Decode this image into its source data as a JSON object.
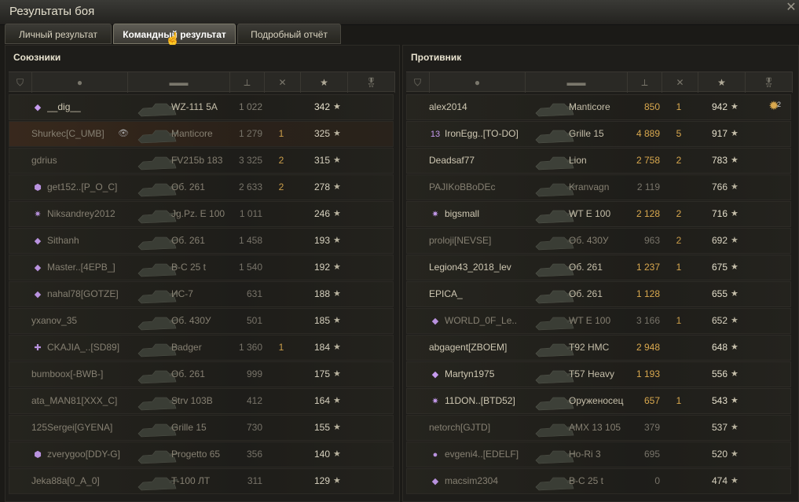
{
  "window": {
    "title": "Результаты боя",
    "close_icon": "close-icon"
  },
  "tabs": [
    {
      "label": "Личный результат",
      "active": false
    },
    {
      "label": "Командный результат",
      "active": true
    },
    {
      "label": "Подробный отчёт",
      "active": false
    }
  ],
  "colors": {
    "damage_highlight": "#d9a84e",
    "text": "#c9c2ad",
    "bg": "#1e1d1a"
  },
  "left": {
    "title": "Союзники",
    "columns": [
      "squad-icon",
      "player-icon",
      "tank-icon",
      "damage-icon",
      "kills-icon",
      "xp-star-icon",
      "medal-icon"
    ],
    "rows": [
      {
        "badge": "◆",
        "name": "__dig__",
        "tank": "WZ-111 5A",
        "damage": "1 022",
        "kills": "",
        "xp": "342",
        "self": false,
        "dead": false
      },
      {
        "badge": "",
        "name": "Shurkec[C_UMB]",
        "tank": "Manticore",
        "damage": "1 279",
        "kills": "1",
        "xp": "325",
        "self": true,
        "dead": true
      },
      {
        "badge": "",
        "name": "gdrius",
        "tank": "FV215b 183",
        "damage": "3 325",
        "kills": "2",
        "xp": "315",
        "self": false,
        "dead": true
      },
      {
        "badge": "⬢",
        "name": "get152..[P_O_C]",
        "tank": "Об. 261",
        "damage": "2 633",
        "kills": "2",
        "xp": "278",
        "self": false,
        "dead": true
      },
      {
        "badge": "✷",
        "name": "Niksandrey2012",
        "tank": "Jg.Pz. E 100",
        "damage": "1 011",
        "kills": "",
        "xp": "246",
        "self": false,
        "dead": true
      },
      {
        "badge": "◆",
        "name": "Sithanh",
        "tank": "Об. 261",
        "damage": "1 458",
        "kills": "",
        "xp": "193",
        "self": false,
        "dead": true
      },
      {
        "badge": "◆",
        "name": "Master..[4EPB_]",
        "tank": "B-C 25 t",
        "damage": "1 540",
        "kills": "",
        "xp": "192",
        "self": false,
        "dead": true
      },
      {
        "badge": "◆",
        "name": "nahal78[GOTZE]",
        "tank": "ИС-7",
        "damage": "631",
        "kills": "",
        "xp": "188",
        "self": false,
        "dead": true
      },
      {
        "badge": "",
        "name": "yxanov_35",
        "tank": "Об. 430У",
        "damage": "501",
        "kills": "",
        "xp": "185",
        "self": false,
        "dead": true
      },
      {
        "badge": "✚",
        "name": "CKAJIA_..[SD89]",
        "tank": "Badger",
        "damage": "1 360",
        "kills": "1",
        "xp": "184",
        "self": false,
        "dead": true
      },
      {
        "badge": "",
        "name": "bumboox[-BWB-]",
        "tank": "Об. 261",
        "damage": "999",
        "kills": "",
        "xp": "175",
        "self": false,
        "dead": true
      },
      {
        "badge": "",
        "name": "ata_MAN81[XXX_C]",
        "tank": "Strv 103B",
        "damage": "412",
        "kills": "",
        "xp": "164",
        "self": false,
        "dead": true
      },
      {
        "badge": "",
        "name": "125Sergei[GYENA]",
        "tank": "Grille 15",
        "damage": "730",
        "kills": "",
        "xp": "155",
        "self": false,
        "dead": true
      },
      {
        "badge": "⬢",
        "name": "zverygoo[DDY-G]",
        "tank": "Progetto 65",
        "damage": "356",
        "kills": "",
        "xp": "140",
        "self": false,
        "dead": true
      },
      {
        "badge": "",
        "name": "Jeka88a[0_A_0]",
        "tank": "T-100 ЛТ",
        "damage": "311",
        "kills": "",
        "xp": "129",
        "self": false,
        "dead": true
      }
    ]
  },
  "right": {
    "title": "Противник",
    "rows": [
      {
        "badge": "",
        "name": "alex2014",
        "tank": "Manticore",
        "damage": "850",
        "kills": "1",
        "xp": "942",
        "medal": "2",
        "hi": true,
        "dead": false
      },
      {
        "badge": "13",
        "name": "IronEgg..[TO-DO]",
        "tank": "Grille 15",
        "damage": "4 889",
        "kills": "5",
        "xp": "917",
        "medal": "",
        "hi": true,
        "dead": false
      },
      {
        "badge": "",
        "name": "Deadsaf77",
        "tank": "Lion",
        "damage": "2 758",
        "kills": "2",
        "xp": "783",
        "medal": "",
        "hi": true,
        "dead": false
      },
      {
        "badge": "",
        "name": "PAJIKoBBoDEc",
        "tank": "Kranvagn",
        "damage": "2 119",
        "kills": "",
        "xp": "766",
        "medal": "",
        "hi": false,
        "dead": true
      },
      {
        "badge": "✷",
        "name": "bigsmall",
        "tank": "WT E 100",
        "damage": "2 128",
        "kills": "2",
        "xp": "716",
        "medal": "",
        "hi": true,
        "dead": false
      },
      {
        "badge": "",
        "name": "proloji[NEVSE]",
        "tank": "Об. 430У",
        "damage": "963",
        "kills": "2",
        "xp": "692",
        "medal": "",
        "hi": false,
        "dead": true
      },
      {
        "badge": "",
        "name": "Legion43_2018_lev",
        "tank": "Об. 261",
        "damage": "1 237",
        "kills": "1",
        "xp": "675",
        "medal": "",
        "hi": true,
        "dead": false
      },
      {
        "badge": "",
        "name": "EPICA_",
        "tank": "Об. 261",
        "damage": "1 128",
        "kills": "",
        "xp": "655",
        "medal": "",
        "hi": true,
        "dead": false
      },
      {
        "badge": "◆",
        "name": "WORLD_0F_Le..",
        "tank": "WT E 100",
        "damage": "3 166",
        "kills": "1",
        "xp": "652",
        "medal": "",
        "hi": false,
        "dead": true
      },
      {
        "badge": "",
        "name": "abgagent[ZBOEM]",
        "tank": "T92 HMC",
        "damage": "2 948",
        "kills": "",
        "xp": "648",
        "medal": "",
        "hi": true,
        "dead": false
      },
      {
        "badge": "◆",
        "name": "Martyn1975",
        "tank": "T57 Heavy",
        "damage": "1 193",
        "kills": "",
        "xp": "556",
        "medal": "",
        "hi": true,
        "dead": false
      },
      {
        "badge": "✷",
        "name": "11DON..[BTD52]",
        "tank": "Оруженосец",
        "damage": "657",
        "kills": "1",
        "xp": "543",
        "medal": "",
        "hi": true,
        "dead": false
      },
      {
        "badge": "",
        "name": "netorch[GJTD]",
        "tank": "AMX 13 105",
        "damage": "379",
        "kills": "",
        "xp": "537",
        "medal": "",
        "hi": false,
        "dead": true
      },
      {
        "badge": "●",
        "name": "evgeni4..[EDELF]",
        "tank": "Ho-Ri 3",
        "damage": "695",
        "kills": "",
        "xp": "520",
        "medal": "",
        "hi": false,
        "dead": true
      },
      {
        "badge": "◆",
        "name": "macsim2304",
        "tank": "B-C 25 t",
        "damage": "0",
        "kills": "",
        "xp": "474",
        "medal": "",
        "hi": false,
        "dead": true
      }
    ]
  }
}
